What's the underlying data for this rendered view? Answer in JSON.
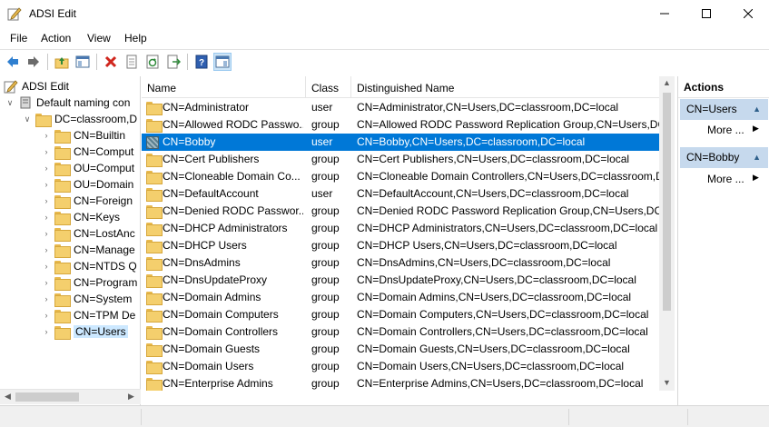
{
  "window": {
    "title": "ADSI Edit"
  },
  "menu": [
    "File",
    "Action",
    "View",
    "Help"
  ],
  "tree": {
    "root": "ADSI Edit",
    "naming_context": "Default naming con",
    "domain": "DC=classroom,D",
    "children": [
      "CN=Builtin",
      "CN=Comput",
      "OU=Comput",
      "OU=Domain",
      "CN=Foreign",
      "CN=Keys",
      "CN=LostAnc",
      "CN=Manage",
      "CN=NTDS Q",
      "CN=Program",
      "CN=System",
      "CN=TPM De",
      "CN=Users"
    ]
  },
  "list": {
    "columns": [
      "Name",
      "Class",
      "Distinguished Name"
    ],
    "rows": [
      [
        "CN=Administrator",
        "user",
        "CN=Administrator,CN=Users,DC=classroom,DC=local"
      ],
      [
        "CN=Allowed RODC Passwo...",
        "group",
        "CN=Allowed RODC Password Replication Group,CN=Users,DC="
      ],
      [
        "CN=Bobby",
        "user",
        "CN=Bobby,CN=Users,DC=classroom,DC=local"
      ],
      [
        "CN=Cert Publishers",
        "group",
        "CN=Cert Publishers,CN=Users,DC=classroom,DC=local"
      ],
      [
        "CN=Cloneable Domain Co...",
        "group",
        "CN=Cloneable Domain Controllers,CN=Users,DC=classroom,D"
      ],
      [
        "CN=DefaultAccount",
        "user",
        "CN=DefaultAccount,CN=Users,DC=classroom,DC=local"
      ],
      [
        "CN=Denied RODC Passwor...",
        "group",
        "CN=Denied RODC Password Replication Group,CN=Users,DC="
      ],
      [
        "CN=DHCP Administrators",
        "group",
        "CN=DHCP Administrators,CN=Users,DC=classroom,DC=local"
      ],
      [
        "CN=DHCP Users",
        "group",
        "CN=DHCP Users,CN=Users,DC=classroom,DC=local"
      ],
      [
        "CN=DnsAdmins",
        "group",
        "CN=DnsAdmins,CN=Users,DC=classroom,DC=local"
      ],
      [
        "CN=DnsUpdateProxy",
        "group",
        "CN=DnsUpdateProxy,CN=Users,DC=classroom,DC=local"
      ],
      [
        "CN=Domain Admins",
        "group",
        "CN=Domain Admins,CN=Users,DC=classroom,DC=local"
      ],
      [
        "CN=Domain Computers",
        "group",
        "CN=Domain Computers,CN=Users,DC=classroom,DC=local"
      ],
      [
        "CN=Domain Controllers",
        "group",
        "CN=Domain Controllers,CN=Users,DC=classroom,DC=local"
      ],
      [
        "CN=Domain Guests",
        "group",
        "CN=Domain Guests,CN=Users,DC=classroom,DC=local"
      ],
      [
        "CN=Domain Users",
        "group",
        "CN=Domain Users,CN=Users,DC=classroom,DC=local"
      ],
      [
        "CN=Enterprise Admins",
        "group",
        "CN=Enterprise Admins,CN=Users,DC=classroom,DC=local"
      ]
    ]
  },
  "actions": {
    "header": "Actions",
    "group1": "CN=Users",
    "group2": "CN=Bobby",
    "more": "More ..."
  },
  "colors": {
    "selection": "#0078d7",
    "tree_selection": "#cce8ff",
    "action_group": "#c6d9ed"
  }
}
